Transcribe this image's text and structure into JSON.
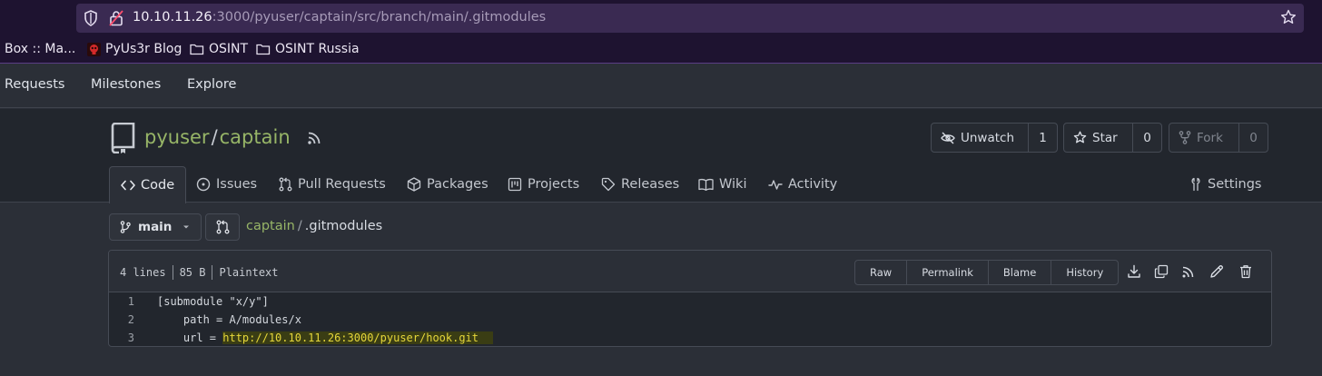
{
  "browser": {
    "url_host": "10.10.11.26",
    "url_path": ":3000/pyuser/captain/src/branch/main/.gitmodules",
    "bookmarks": [
      {
        "label": "Box :: Ma..."
      },
      {
        "label": "PyUs3r Blog"
      },
      {
        "label": "OSINT"
      },
      {
        "label": "OSINT Russia"
      }
    ]
  },
  "topnav": {
    "items": [
      "Requests",
      "Milestones",
      "Explore"
    ]
  },
  "repo": {
    "owner": "pyuser",
    "sep": "/",
    "name": "captain",
    "watch": {
      "label": "Unwatch",
      "count": "1"
    },
    "star": {
      "label": "Star",
      "count": "0"
    },
    "fork": {
      "label": "Fork",
      "count": "0"
    },
    "tabs": [
      {
        "label": "Code",
        "icon": "code-icon"
      },
      {
        "label": "Issues",
        "icon": "issue-icon"
      },
      {
        "label": "Pull Requests",
        "icon": "pull-request-icon"
      },
      {
        "label": "Packages",
        "icon": "package-icon"
      },
      {
        "label": "Projects",
        "icon": "project-icon"
      },
      {
        "label": "Releases",
        "icon": "tag-icon"
      },
      {
        "label": "Wiki",
        "icon": "book-icon"
      },
      {
        "label": "Activity",
        "icon": "pulse-icon"
      },
      {
        "label": "Settings",
        "icon": "tools-icon"
      }
    ]
  },
  "branch": {
    "name": "main",
    "crumb_repo": "captain",
    "crumb_sep": "/",
    "crumb_file": ".gitmodules"
  },
  "file": {
    "lines": "4 lines",
    "size": "85 B",
    "type": "Plaintext",
    "actions": [
      "Raw",
      "Permalink",
      "Blame",
      "History"
    ],
    "code": [
      {
        "n": "1",
        "text": "[submodule \"x/y\"]"
      },
      {
        "n": "2",
        "text": "    path = A/modules/x"
      },
      {
        "n": "3",
        "prefix": "    url = ",
        "link": "http://10.10.11.26:3000/pyuser/hook.git"
      }
    ]
  },
  "colors": {
    "accent_green": "#97b567",
    "browser_bg": "#1e1330",
    "page_bg": "#2b2f37",
    "highlight": "#e6d73a"
  }
}
